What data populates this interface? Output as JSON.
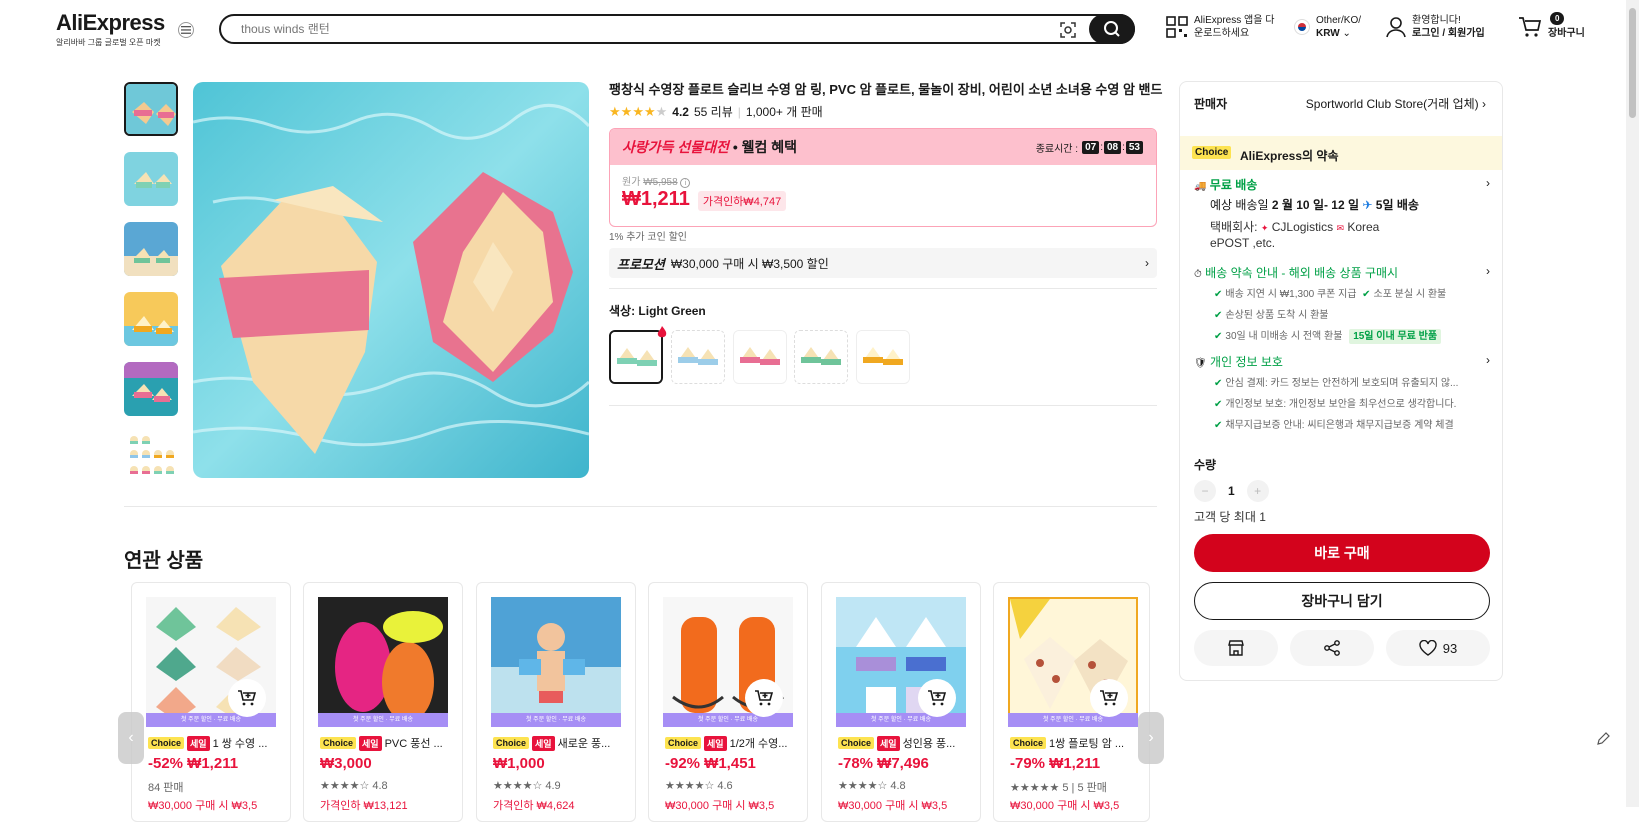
{
  "header": {
    "logo": "AliExpress",
    "logo_sub": "알리바바 그룹 글로벌 오픈 마켓",
    "search_placeholder": "thous winds 랜턴",
    "app_line1": "AliExpress 앱을 다",
    "app_line2": "운로드하세요",
    "locale_line1": "Other/KO/",
    "locale_line2": "KRW",
    "account_line1": "환영합니다!",
    "account_line2": "로그인 / 회원가입",
    "cart_count": "0",
    "cart_label": "장바구니"
  },
  "product": {
    "title": "팽창식 수영장 플로트 슬리브 수영 암 링, PVC 암 플로트, 물놀이 장비, 어린이 소년 소녀용 수영 암 밴드",
    "rating": "4.2",
    "rating_stars": 4,
    "reviews": "55 리뷰",
    "sold": "1,000+ 개 판매",
    "promo_title_hl": "사랑가득 선물대전",
    "promo_title_rest": " • 웰컴 혜택",
    "timer_label": "종료시간 :",
    "timer": [
      "07",
      "08",
      "53"
    ],
    "orig_label": "원가",
    "orig_price": "₩5,958",
    "price": "₩1,211",
    "discount": "가격인하₩4,747",
    "coin": "1% 추가 코인 할인",
    "promotion_label": "프로모션",
    "promotion_text": "₩30,000 구매 시 ₩3,500 할인",
    "color_label": "색상:",
    "color_value": "Light Green"
  },
  "panel": {
    "seller_label": "판매자",
    "seller_name": "Sportworld Club Store(거래 업체)",
    "choice": "Choice",
    "promise": "AliExpress의 약속",
    "free_shipping": "무료 배송",
    "delivery_prefix": "예상 배송일 ",
    "delivery_dates": "2 월 10 일- 12 일",
    "delivery_days": "5일 배송",
    "carrier_label": "택배회사:",
    "carrier1": "CJLogistics",
    "carrier2": "Korea",
    "carrier3": "ePOST ,etc.",
    "promise_guide": "배송 약속 안내 - 해외 배송 상품 구매시",
    "g1a": "배송 지연 시 ₩1,300 쿠폰 지급",
    "g1b": "소포 분실 시 환불",
    "g2": "손상된 상품 도착 시 환불",
    "g3": "30일 내 미배송 시 전액 환불",
    "g3tag": "15일 이내 무료 반품",
    "privacy": "개인 정보 보호",
    "p1": "안심 결제: 카드 정보는 안전하게 보호되며 유출되지 않...",
    "p2": "개인정보 보호: 개인정보 보안을 최우선으로 생각합니다.",
    "p3": "채무지급보증 안내: 씨티은행과 채무지급보증 계약 체결",
    "qty_label": "수량",
    "qty": "1",
    "limit": "고객 당 최대 1",
    "buy_now": "바로 구매",
    "add_cart": "장바구니 담기",
    "likes": "93"
  },
  "related": {
    "title": "연관 상품",
    "banner": "첫 주문 할인 · 무료 배송",
    "cards": [
      {
        "choice": "Choice",
        "sale": "세일",
        "name": "1 쌍 수영 ...",
        "price": "-52% ₩1,211",
        "meta": "84 판매",
        "meta2": "₩30,000 구매 시 ₩3,5"
      },
      {
        "choice": "Choice",
        "sale": "세일",
        "name": "PVC 풍선 ...",
        "price": "₩3,000",
        "meta": "★★★★☆ 4.8",
        "meta2": "가격인하 ₩13,121"
      },
      {
        "choice": "Choice",
        "sale": "세일",
        "name": "새로운 풍...",
        "price": "₩1,000",
        "meta": "★★★★☆ 4.9",
        "meta2": "가격인하 ₩4,624"
      },
      {
        "choice": "Choice",
        "sale": "세일",
        "name": "1/2개 수영...",
        "price": "-92% ₩1,451",
        "meta": "★★★★☆ 4.6",
        "meta2": "₩30,000 구매 시 ₩3,5"
      },
      {
        "choice": "Choice",
        "sale": "세일",
        "name": "성인용 풍...",
        "price": "-78% ₩7,496",
        "meta": "★★★★☆ 4.8",
        "meta2": "₩30,000 구매 시 ₩3,5"
      },
      {
        "choice": "Choice",
        "sale": "",
        "name": "1쌍 플로팅 암 ...",
        "price": "-79% ₩1,211",
        "meta": "★★★★★ 5 | 5 판매",
        "meta2": "₩30,000 구매 시 ₩3,5"
      }
    ]
  }
}
